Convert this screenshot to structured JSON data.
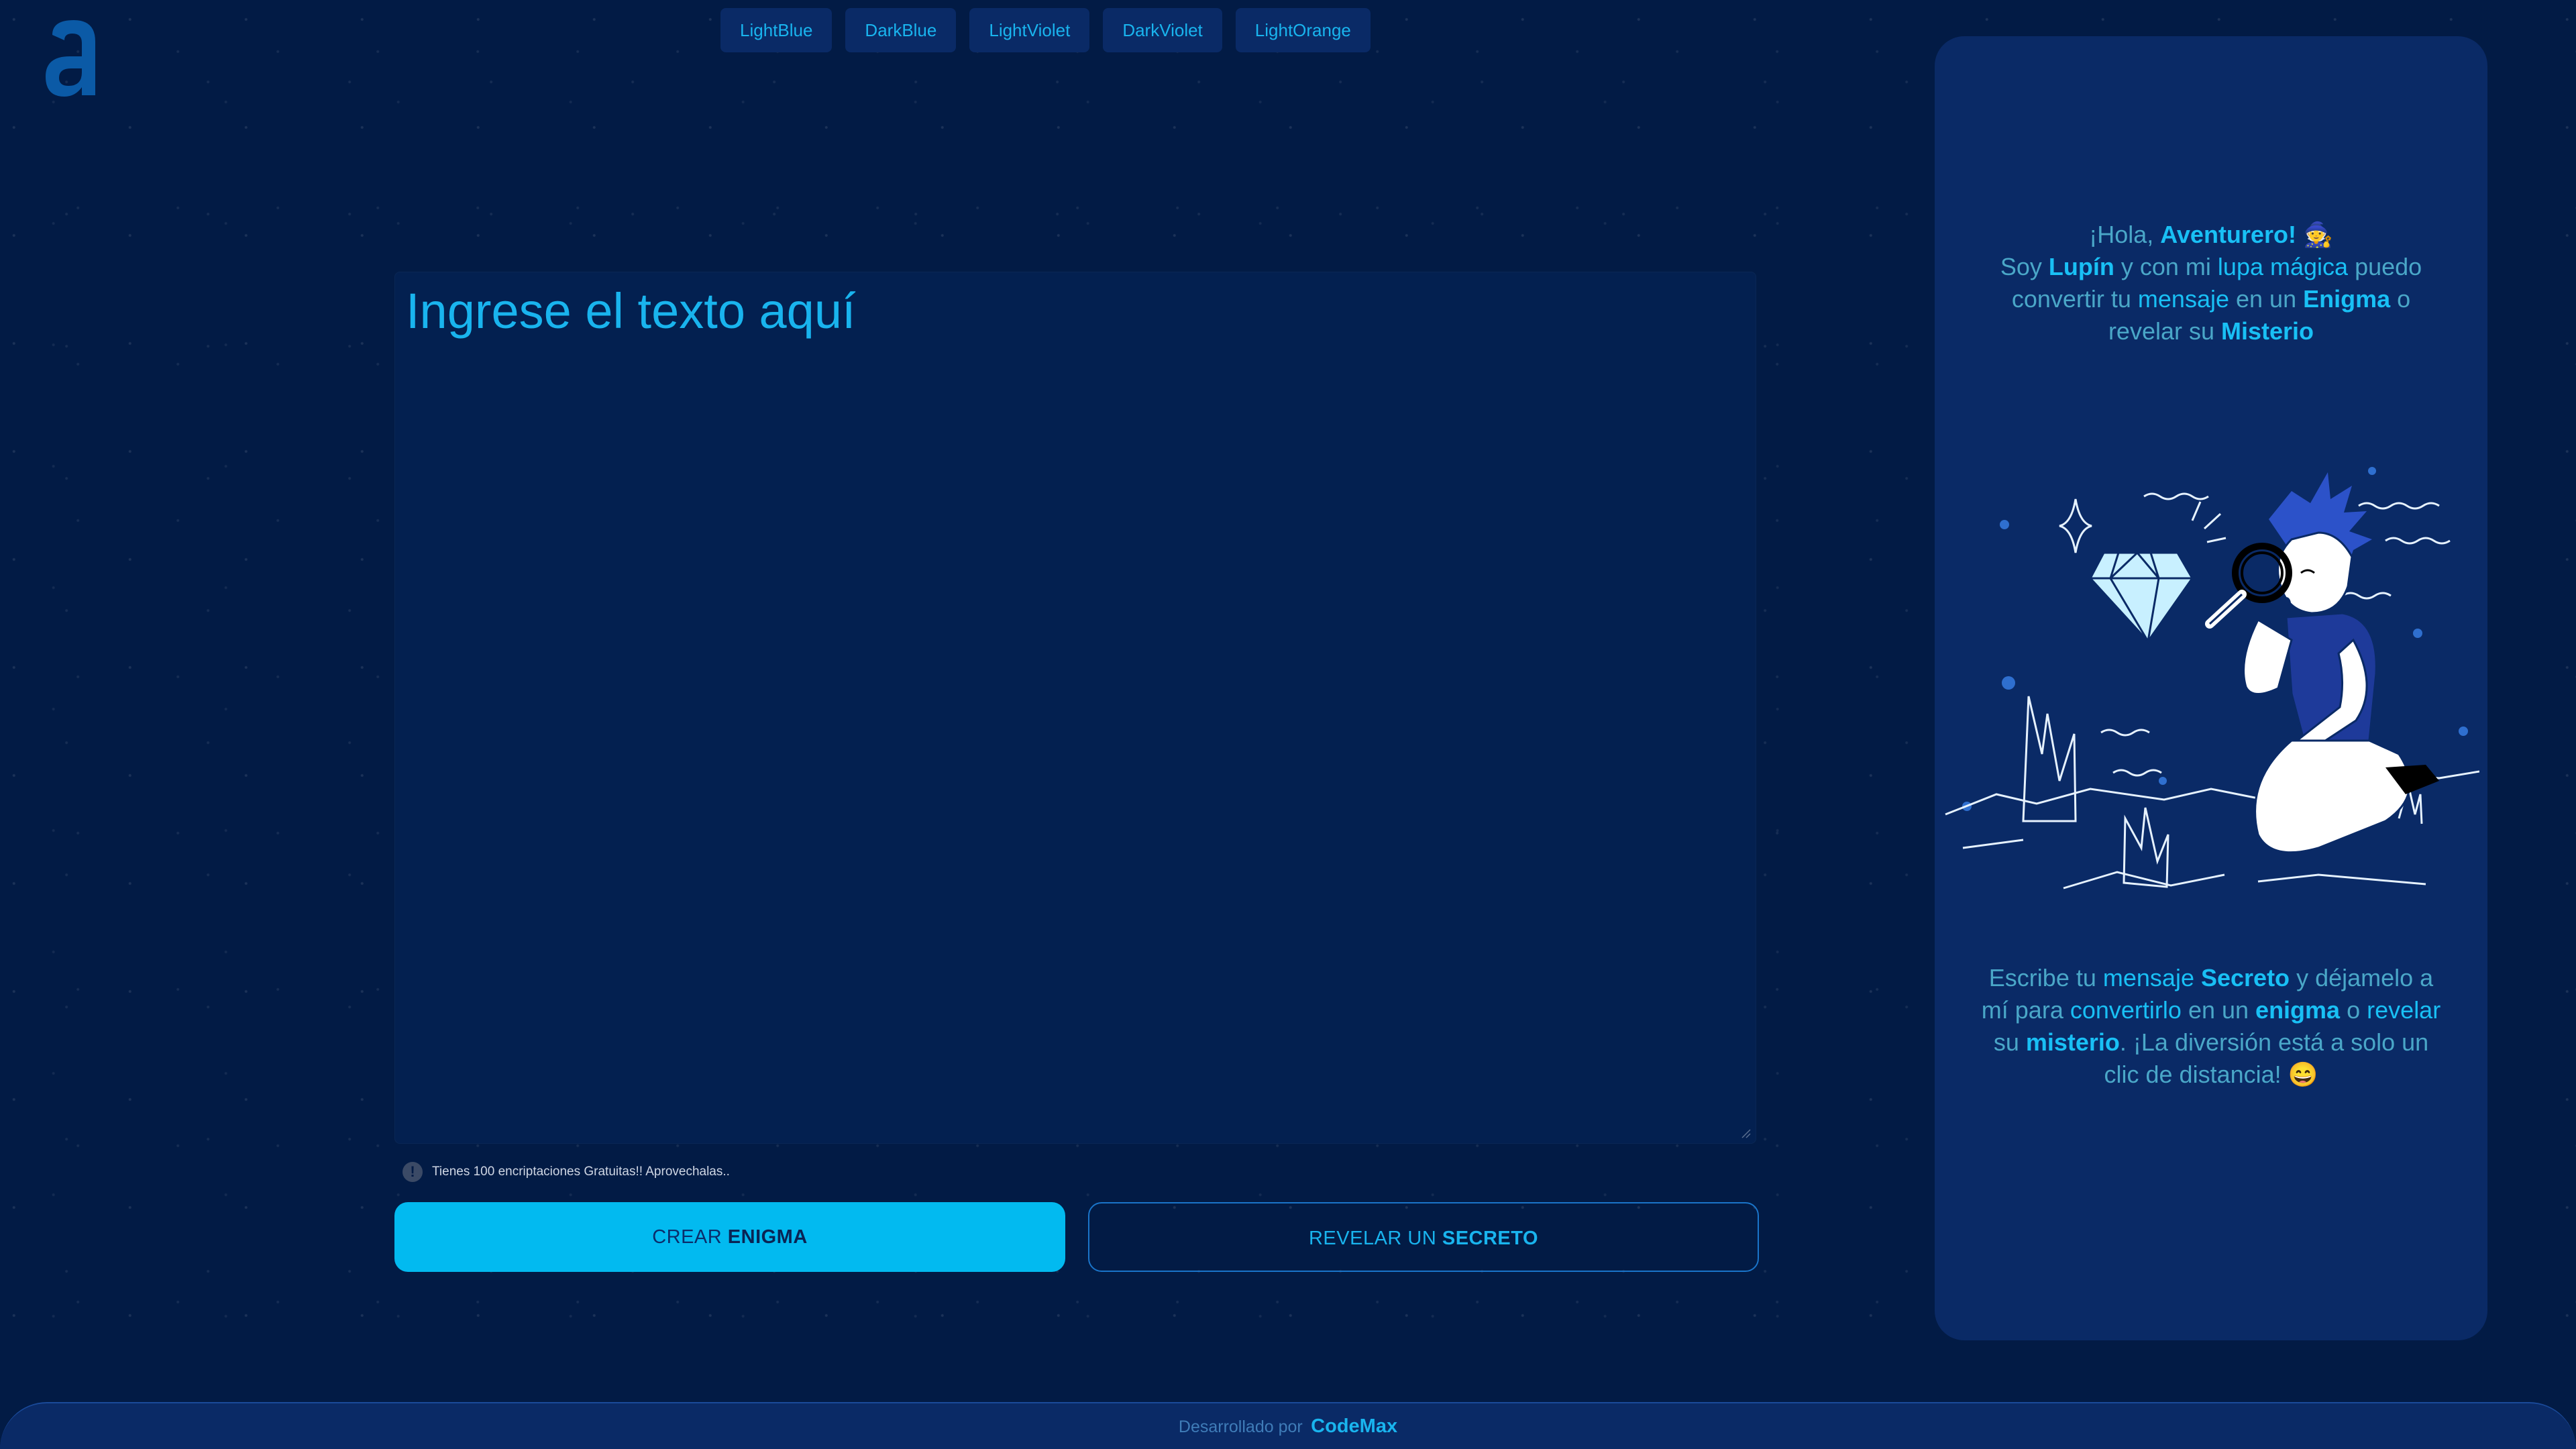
{
  "theme_buttons": [
    "LightBlue",
    "DarkBlue",
    "LightViolet",
    "DarkViolet",
    "LightOrange"
  ],
  "editor": {
    "placeholder": "Ingrese el texto aquí"
  },
  "info": {
    "text": "Tienes 100 encriptaciones Gratuitas!! Aprovechalas.."
  },
  "actions": {
    "create_prefix": "CREAR",
    "create_bold": "ENIGMA",
    "reveal_prefix": "REVELAR UN",
    "reveal_bold": "SECRETO"
  },
  "panel": {
    "greeting": {
      "hola": "¡Hola,",
      "aventurero": "Aventurero!",
      "emoji": "🧙",
      "soy": "Soy",
      "lupin": "Lupín",
      "con_mi": "y con mi",
      "lupa": "lupa mágica",
      "puedo": "puedo convertir tu",
      "mensaje": "mensaje",
      "en_un": "en un",
      "enigma": "Enigma",
      "o": "o",
      "revelar_su": "revelar su",
      "misterio": "Misterio"
    },
    "bottom": {
      "escribe": "Escribe tu",
      "mensaje": "mensaje",
      "secreto": "Secreto",
      "dejamelo": "y déjamelo a mí para",
      "convertirlo": "convertirlo",
      "en_un": "en un",
      "enigma": "enigma",
      "o": "o",
      "revelar": "revelar",
      "su": "su",
      "misterio": "misterio",
      "rest": ". ¡La diversión está a solo un clic de distancia!",
      "emoji": "😄"
    }
  },
  "footer": {
    "developed_by": "Desarrollado por",
    "brand": "CodeMax"
  },
  "colors": {
    "background": "#021b45",
    "panel": "#0a2a66",
    "accent": "#19b4ee",
    "primary_button": "#02baf0"
  }
}
